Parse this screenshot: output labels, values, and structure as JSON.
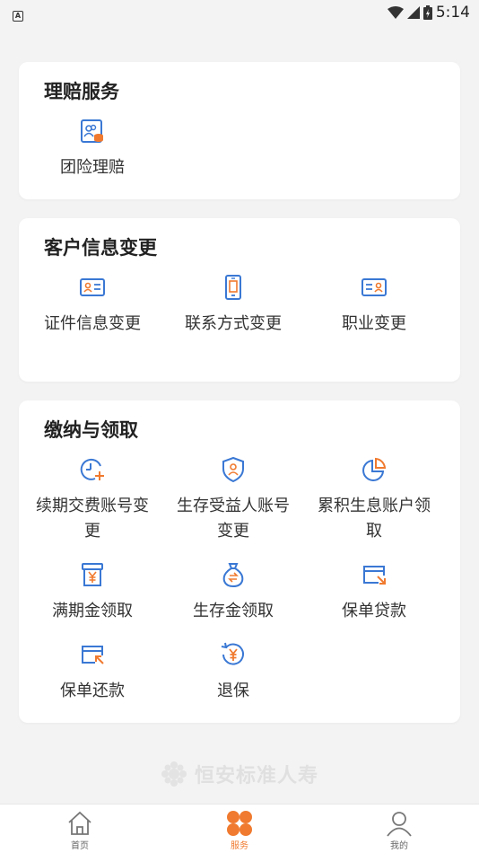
{
  "status": {
    "time": "5:14",
    "left_badge": "A"
  },
  "cards": [
    {
      "title": "理赔服务",
      "items": [
        {
          "label": "团险理赔",
          "icon": "group-claim-icon"
        }
      ]
    },
    {
      "title": "客户信息变更",
      "items": [
        {
          "label": "证件信息变更",
          "icon": "id-card-icon"
        },
        {
          "label": "联系方式变更",
          "icon": "phone-icon"
        },
        {
          "label": "职业变更",
          "icon": "profession-card-icon"
        }
      ]
    },
    {
      "title": "缴纳与领取",
      "items": [
        {
          "label": "续期交费账号变更",
          "icon": "clock-plus-icon"
        },
        {
          "label": "生存受益人账号变更",
          "icon": "shield-user-icon"
        },
        {
          "label": "累积生息账户领取",
          "icon": "pie-chart-icon"
        },
        {
          "label": "满期金领取",
          "icon": "yen-box-icon"
        },
        {
          "label": "生存金领取",
          "icon": "money-bag-icon"
        },
        {
          "label": "保单贷款",
          "icon": "card-arrow-out-icon"
        },
        {
          "label": "保单还款",
          "icon": "card-arrow-in-icon"
        },
        {
          "label": "退保",
          "icon": "yen-refund-icon"
        }
      ]
    }
  ],
  "watermark": "恒安标准人寿",
  "tabbar": {
    "tabs": [
      {
        "label": "首页",
        "icon": "home-icon",
        "active": false
      },
      {
        "label": "服务",
        "icon": "service-grid-icon",
        "active": true
      },
      {
        "label": "我的",
        "icon": "user-icon",
        "active": false
      }
    ]
  },
  "colors": {
    "icon_blue": "#3a78d4",
    "accent_orange": "#f07a2f",
    "background": "#f3f3f3",
    "card": "#ffffff"
  }
}
